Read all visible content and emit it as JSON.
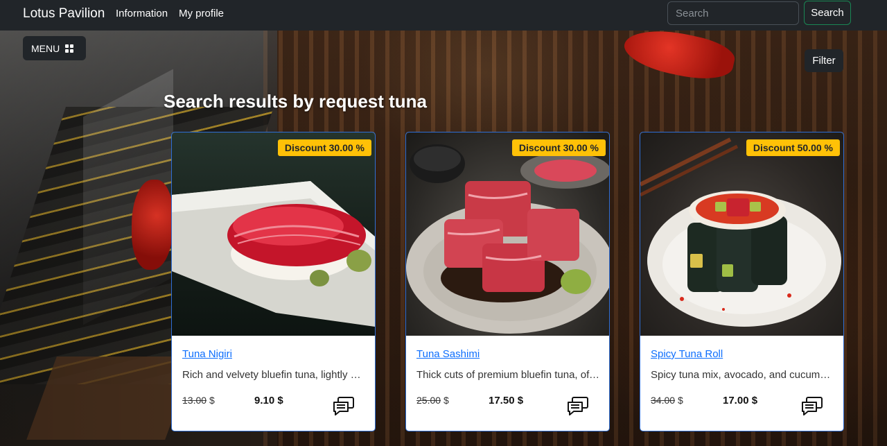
{
  "navbar": {
    "brand": "Lotus Pavilion",
    "links": [
      "Information",
      "My profile"
    ],
    "search_placeholder": "Search",
    "search_button": "Search"
  },
  "menu_button": "MENU",
  "filter_button": "Filter",
  "results_title": "Search results by request tuna",
  "colors": {
    "navbar_bg": "#212529",
    "discount_badge": "#ffc107",
    "link": "#0d6efd",
    "search_button_border": "#198754"
  },
  "cards": [
    {
      "discount": "Discount 30.00 %",
      "title": "Tuna Nigiri",
      "description": "Rich and velvety bluefin tuna, lightly pressed over seasoned rice",
      "old_price": "13.00",
      "old_currency": "$",
      "new_price": "9.10 $",
      "icon": "chat-icon"
    },
    {
      "discount": "Discount 30.00 %",
      "title": "Tuna Sashimi",
      "description": "Thick cuts of premium bluefin tuna, offered with soy and wasabi",
      "old_price": "25.00",
      "old_currency": "$",
      "new_price": "17.50 $",
      "icon": "chat-icon"
    },
    {
      "discount": "Discount 50.00 %",
      "title": "Spicy Tuna Roll",
      "description": "Spicy tuna mix, avocado, and cucumber wrapped in nori and rice",
      "old_price": "34.00",
      "old_currency": "$",
      "new_price": "17.00 $",
      "icon": "chat-icon"
    }
  ]
}
